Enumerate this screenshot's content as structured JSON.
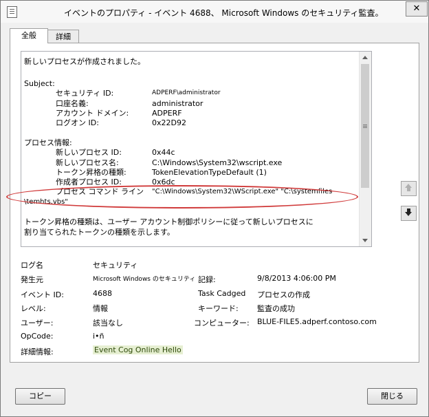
{
  "window": {
    "title": "イベントのプロパティ - イベント 4688、 Microsoft Windows のセキュリティ監査。",
    "close_symbol": "✕"
  },
  "tabs": {
    "general": "全般",
    "details": "詳細"
  },
  "description": {
    "intro": "新しいプロセスが作成されました。",
    "subject_header": "Subject:",
    "subject": [
      {
        "label": "セキュリティ ID:",
        "value": "ADPERF\\administrator"
      },
      {
        "label": "口座名義:",
        "value": "administrator"
      },
      {
        "label": "アカウント ドメイン:",
        "value": "ADPERF"
      },
      {
        "label": "ログオン ID:",
        "value": "0x22D92"
      }
    ],
    "process_header": "プロセス情報:",
    "process": [
      {
        "label": "新しいプロセス ID:",
        "value": "0x44c"
      },
      {
        "label": "新しいプロセス名:",
        "value": "C:\\Windows\\System32\\wscript.exe"
      },
      {
        "label": "トークン昇格の種類:",
        "value": "TokenElevationTypeDefault (1)"
      },
      {
        "label": "作成者プロセス ID:",
        "value": "0x6dc"
      },
      {
        "label": "プロセス コマンド ライン",
        "value": "\"C:\\Windows\\System32\\WScript.exe\" \"C:\\systemfiles"
      }
    ],
    "cmdline_cont": "\\temhts.vbs\"",
    "note_line1": "トークン昇格の種類は、ユーザー アカウント制御ポリシーに従って新しいプロセスに",
    "note_line2": "割り当てられたトークンの種類を示します。"
  },
  "properties": {
    "log_name_label": "ログ名",
    "log_name": "セキュリティ",
    "source_label": "発生元",
    "source": "Microsoft Windows のセキュリティ",
    "logged_label": "記録:",
    "logged": "9/8/2013 4:06:00 PM",
    "event_id_label": "イベント ID:",
    "event_id": "4688",
    "task_category_label": "Task Cadged",
    "task_category": "プロセスの作成",
    "level_label": "レベル:",
    "level": "情報",
    "keywords_label": "キーワード:",
    "keywords": "監査の成功",
    "user_label": "ユーザー:",
    "user": "該当なし",
    "computer_label": "コンピューター:",
    "computer": "BLUE-FILE5.adperf.contoso.com",
    "opcode_label": "OpCode:",
    "opcode": "i•ñ",
    "more_info_label": "詳細情報:",
    "more_info_link": "Event Cog Online Hello"
  },
  "buttons": {
    "copy": "コピー",
    "close": "閉じる"
  }
}
